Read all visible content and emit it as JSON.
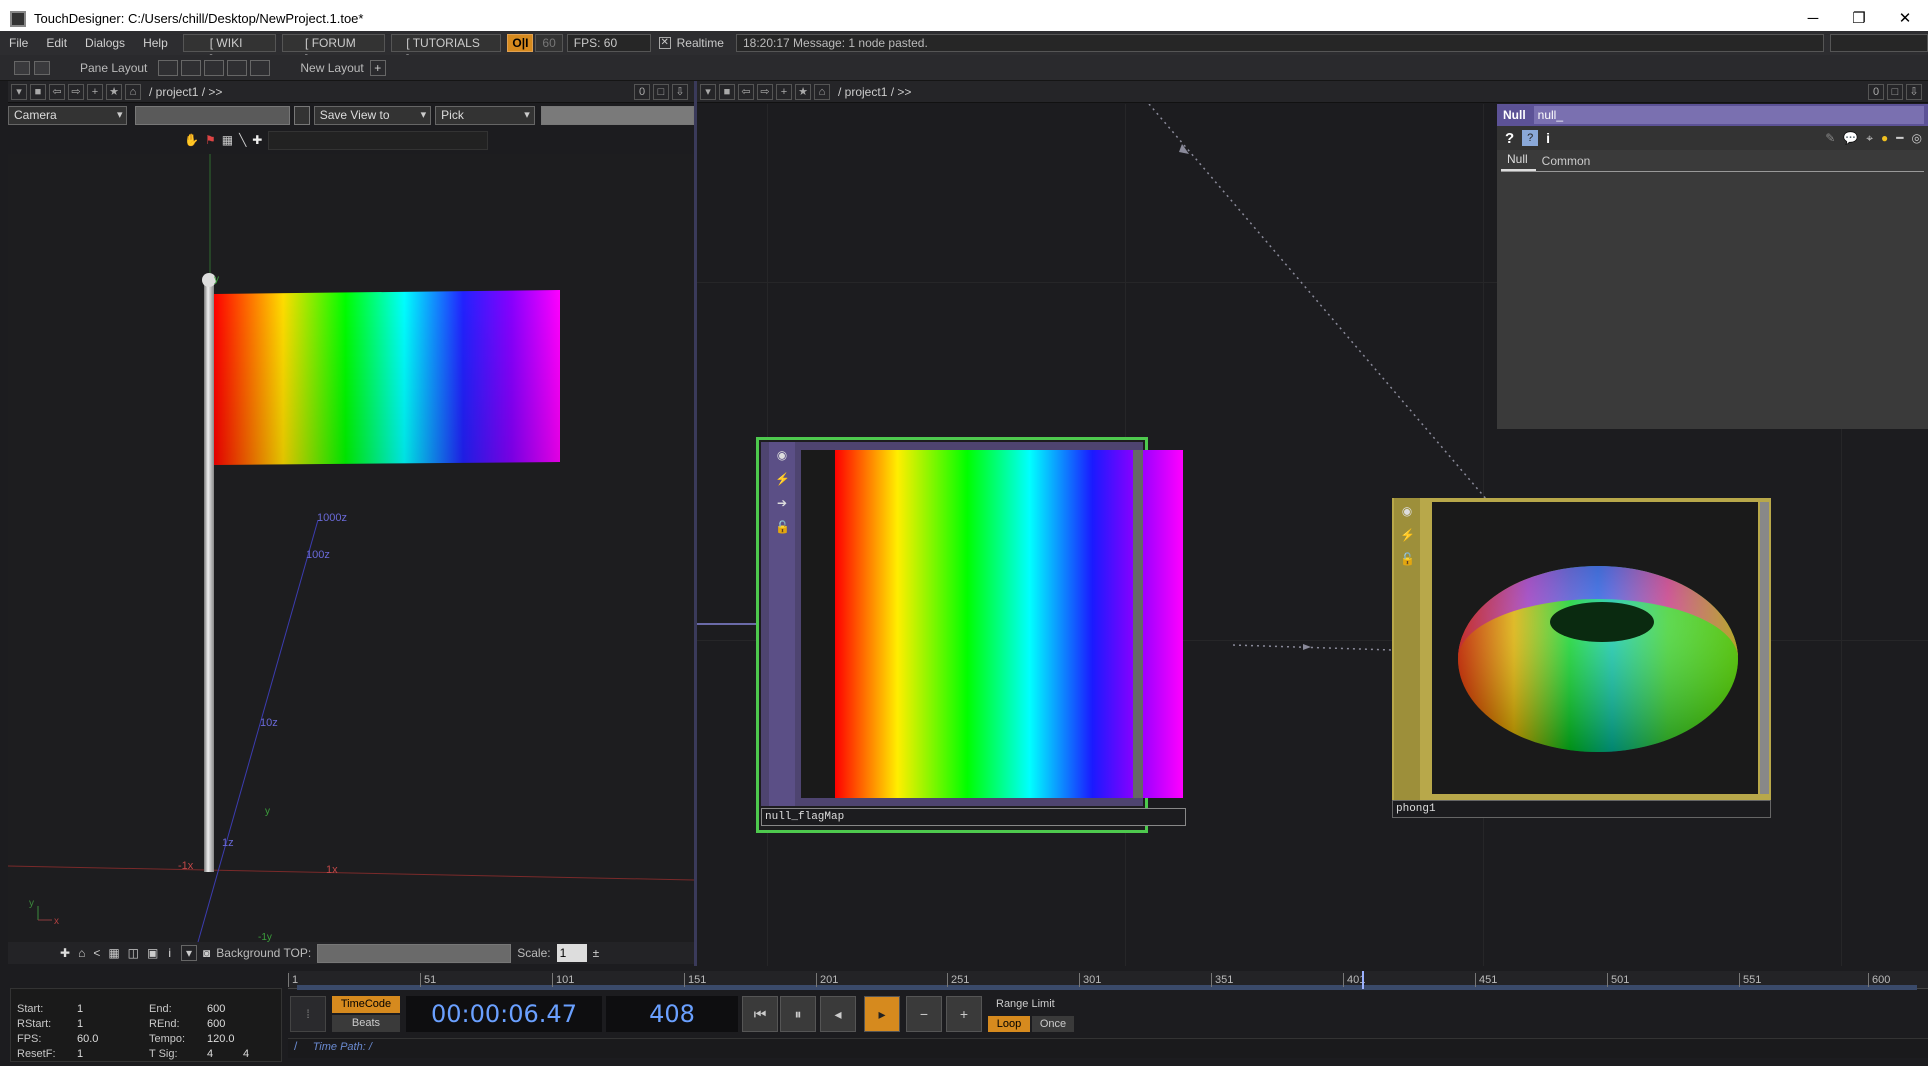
{
  "window": {
    "title": "TouchDesigner: C:/Users/chill/Desktop/NewProject.1.toe*",
    "controls": [
      "─",
      "❐",
      "✕"
    ]
  },
  "menubar": {
    "items": [
      "File",
      "Edit",
      "Dialogs",
      "Help"
    ],
    "wiki": "[ WIKI ]",
    "forum": "[ FORUM ]",
    "tutorials": "[ TUTORIALS ]",
    "oi": "O|I",
    "fps_cap": "60",
    "fps": "FPS:  60",
    "realtime": "Realtime",
    "realtime_checked": true,
    "message": "18:20:17 Message: 1 node pasted."
  },
  "layoutbar": {
    "pane_layout": "Pane Layout",
    "new_layout": "New Layout"
  },
  "left_pane": {
    "path": "project1 / >>",
    "counter": "0",
    "camera_dd": "Camera",
    "view_dd": "Save View to",
    "pick_dd": "Pick",
    "background_top_label": "Background TOP:",
    "scale_label": "Scale:",
    "scale_value": "1",
    "axis_labels": {
      "z1000": "1000z",
      "z100": "100z",
      "z10": "10z",
      "z1": "1z",
      "xneg": "-1x",
      "xpos": "1x",
      "y": "y",
      "ytop": "y",
      "yneg": "-1y",
      "gizmo_y": "y",
      "gizmo_x": "x"
    }
  },
  "network_pane": {
    "path": "project1 / >>",
    "counter": "0"
  },
  "nodes": {
    "null_flagmap": {
      "name": "null_flagMap"
    },
    "phong1": {
      "name": "phong1"
    }
  },
  "params": {
    "type": "Null",
    "name": "null_",
    "tabs": [
      "Null",
      "Common"
    ]
  },
  "timeline": {
    "ticks": [
      "1",
      "51",
      "101",
      "151",
      "201",
      "251",
      "301",
      "351",
      "401",
      "451",
      "501",
      "551",
      "600"
    ],
    "start_label": "Start:",
    "start": "1",
    "rstart_label": "RStart:",
    "rstart": "1",
    "fps_label": "FPS:",
    "fps": "60.0",
    "resetf_label": "ResetF:",
    "resetf": "1",
    "end_label": "End:",
    "end": "600",
    "rend_label": "REnd:",
    "rend": "600",
    "tempo_label": "Tempo:",
    "tempo": "120.0",
    "tsig_label": "T Sig:",
    "tsig_a": "4",
    "tsig_b": "4",
    "timecode_btn": "TimeCode",
    "beats_btn": "Beats",
    "timecode": "00:00:06.47",
    "frame": "408",
    "range_limit": "Range Limit",
    "loop": "Loop",
    "once": "Once",
    "time_path": "Time Path: /",
    "current_frame": 408
  },
  "colors": {
    "accent": "#d68a1e",
    "selected_node": "#4ec94e",
    "null_node": "#5b4f86",
    "mat_node": "#b8a84a"
  }
}
